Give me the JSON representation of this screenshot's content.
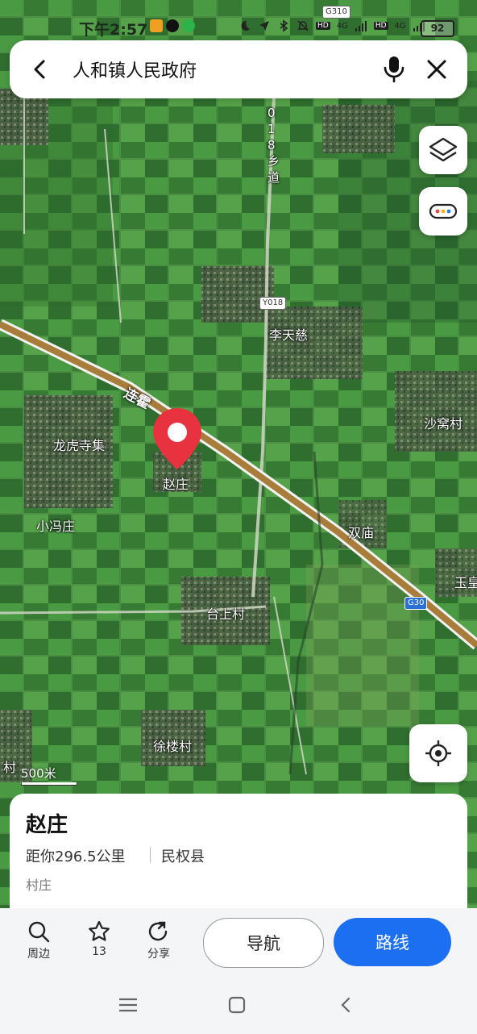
{
  "status_bar": {
    "time": "下午2:57",
    "battery": "92",
    "network_1": "4G",
    "network_2": "4G",
    "hd_1": "HD",
    "hd_2": "HD"
  },
  "search": {
    "query": "人和镇人民政府"
  },
  "map": {
    "labels": {
      "li_tian_ci": "李天慈",
      "sha_wo_cun": "沙窝村",
      "long_hu_si_ji": "龙虎寺集",
      "zhao_zhuang": "赵庄",
      "xiao_feng_zhuang": "小冯庄",
      "shuang_miao": "双庙",
      "tai_shang_cun": "台上村",
      "xu_lou_cun": "徐楼村",
      "yu_huang": "玉皇",
      "edge_cun": "村",
      "lian_huo": "连霍",
      "road_018": "0 1 8 乡 道"
    },
    "shields": {
      "y018": "Y018",
      "g30": "G30",
      "g310": "G310"
    },
    "scale": "500米"
  },
  "place_card": {
    "name": "赵庄",
    "distance": "距你296.5公里",
    "county": "民权县",
    "type": "村庄"
  },
  "actions": {
    "nearby": "周边",
    "favorites_count": "13",
    "share": "分享",
    "navigate": "导航",
    "route": "路线"
  },
  "colors": {
    "accent_blue": "#1c6ff0",
    "pin_red": "#e8323f"
  }
}
